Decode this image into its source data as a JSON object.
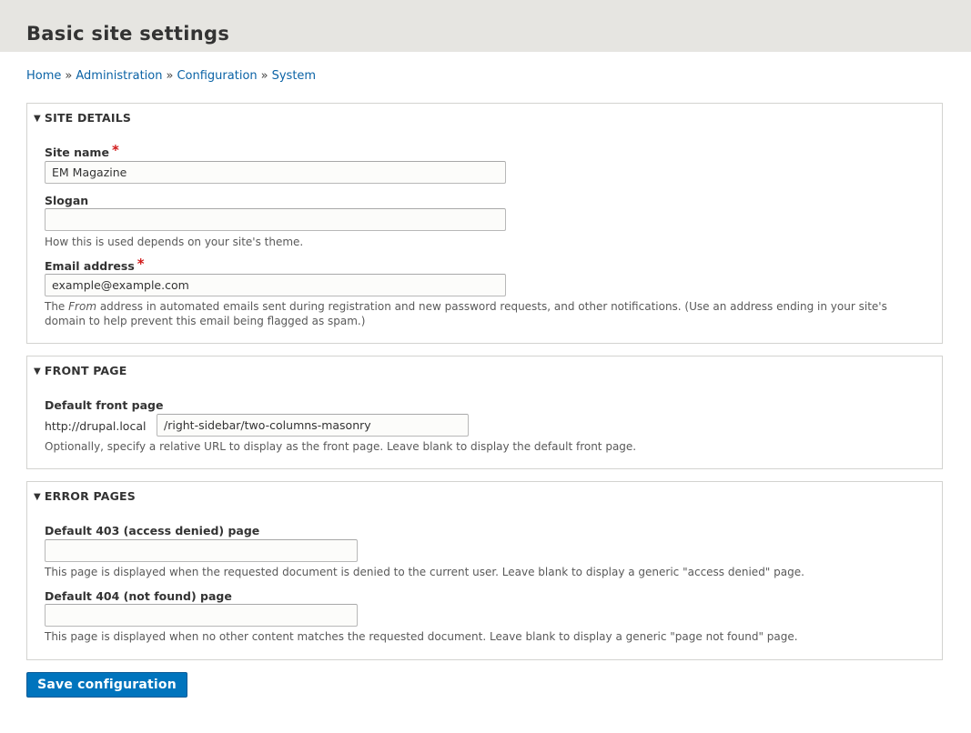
{
  "page": {
    "title": "Basic site settings"
  },
  "breadcrumb": {
    "items": [
      "Home",
      "Administration",
      "Configuration",
      "System"
    ],
    "separator": "»"
  },
  "site_details": {
    "legend": "SITE DETAILS",
    "site_name": {
      "label": "Site name",
      "required": "*",
      "value": "EM Magazine"
    },
    "slogan": {
      "label": "Slogan",
      "value": "",
      "description": "How this is used depends on your site's theme."
    },
    "email": {
      "label": "Email address",
      "required": "*",
      "value": "example@example.com",
      "description_pre": "The ",
      "description_em": "From",
      "description_post": " address in automated emails sent during registration and new password requests, and other notifications. (Use an address ending in your site's domain to help prevent this email being flagged as spam.)"
    }
  },
  "front_page": {
    "legend": "FRONT PAGE",
    "default_front_page": {
      "label": "Default front page",
      "prefix": "http://drupal.local",
      "value": "/right-sidebar/two-columns-masonry",
      "description": "Optionally, specify a relative URL to display as the front page. Leave blank to display the default front page."
    }
  },
  "error_pages": {
    "legend": "ERROR PAGES",
    "page_403": {
      "label": "Default 403 (access denied) page",
      "value": "",
      "description": "This page is displayed when the requested document is denied to the current user. Leave blank to display a generic \"access denied\" page."
    },
    "page_404": {
      "label": "Default 404 (not found) page",
      "value": "",
      "description": "This page is displayed when no other content matches the requested document. Leave blank to display a generic \"page not found\" page."
    }
  },
  "actions": {
    "save_label": "Save configuration"
  },
  "icons": {
    "collapse": "triangle-down-icon"
  },
  "colors": {
    "link": "#0b63a6",
    "required": "#d11a1a",
    "primary_button": "#0074bd",
    "header_bg": "#e6e5e1"
  }
}
